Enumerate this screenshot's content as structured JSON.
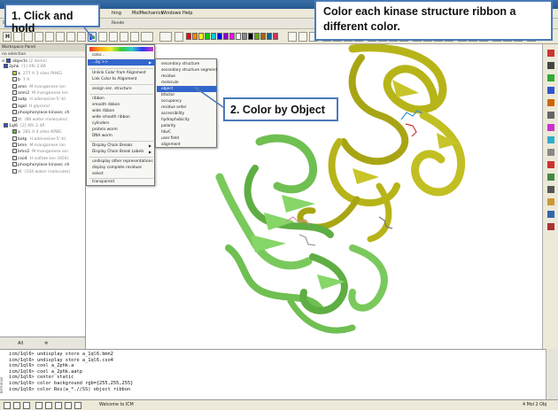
{
  "menubar": {
    "items": [
      "hing",
      "MolMechanics",
      "Windows",
      "Help"
    ]
  },
  "tabs": [
    "Struct",
    "Apps",
    "Fav",
    "Win",
    "Rende"
  ],
  "palette_colors": [
    "#ff0000",
    "#ff8800",
    "#ffff00",
    "#00cc00",
    "#00cccc",
    "#0000ff",
    "#8800cc",
    "#ff00ff",
    "#ffffff",
    "#888888",
    "#000000",
    "#66aa00",
    "#aa6600",
    "#006699",
    "#cc3366"
  ],
  "workspace": {
    "title": "Workspace Panel",
    "selection": "no selection",
    "objects_label": "objects",
    "objects_count": "(2 items)",
    "tree": [
      {
        "indent": 4,
        "color": "#3355cc",
        "name": "2phk",
        "detail": "[1] XRi 2.8Å",
        "gray": false
      },
      {
        "indent": 14,
        "color": "#cccc33",
        "name": "a",
        "detail": "277 A 3 sites PHKG",
        "gray": false
      },
      {
        "indent": 14,
        "color": "#ffffff",
        "name": "b",
        "detail": "7 A",
        "gray": false
      },
      {
        "indent": 14,
        "color": "#ffffff",
        "name": "amn",
        "detail": "M  manganese ion",
        "gray": false
      },
      {
        "indent": 14,
        "color": "#ffffff",
        "name": "amn2",
        "detail": "M  manganese ion",
        "gray": false
      },
      {
        "indent": 14,
        "color": "#ffffff",
        "name": "aatp",
        "detail": "H  adenosine-5'-tri",
        "gray": false
      },
      {
        "indent": 14,
        "color": "#ffffff",
        "name": "agol",
        "detail": "H  glycerol",
        "gray": false
      },
      {
        "indent": 14,
        "color": "#ffffff",
        "name": "phosphorylase kinase; ch",
        "detail": "",
        "gray": false
      },
      {
        "indent": 14,
        "color": "#ffffff",
        "name": "W",
        "detail": "(86 water molecules)",
        "gray": true
      },
      {
        "indent": 4,
        "color": "#3355cc",
        "name": "1ql6",
        "detail": "[2] XRi 2.4Å",
        "gray": false
      },
      {
        "indent": 14,
        "color": "#66bb44",
        "name": "a",
        "detail": "281 A 4 sites KPBG",
        "gray": false
      },
      {
        "indent": 14,
        "color": "#ffffff",
        "name": "batp",
        "detail": "H  adenosine-5'-tri",
        "gray": false
      },
      {
        "indent": 14,
        "color": "#ffffff",
        "name": "bmn",
        "detail": "M  manganese ion",
        "gray": false
      },
      {
        "indent": 14,
        "color": "#ffffff",
        "name": "bmn2",
        "detail": "M  manganese ion",
        "gray": false
      },
      {
        "indent": 14,
        "color": "#ffffff",
        "name": "cso4",
        "detail": "H  sulfate-ion (SO4)",
        "gray": false
      },
      {
        "indent": 14,
        "color": "#ffffff",
        "name": "phosphorylase kinase; ch",
        "detail": "",
        "gray": false
      },
      {
        "indent": 14,
        "color": "#ffffff",
        "name": "W",
        "detail": "(104 water molecules)",
        "gray": true
      }
    ],
    "bottom_tabs": [
      "All",
      "✲"
    ]
  },
  "context_menu": {
    "header": "color...",
    "items": [
      "...by >>",
      "Unlink Color from Alignment",
      "Link Color to Alignment",
      "assign sec. structure",
      "ribbon",
      "smooth ribbon",
      "wide ribbon",
      "wide smooth ribbon",
      "cylinders",
      "protein worm",
      "DNA worm",
      "Display Chain Breaks",
      "Display Chain Break Labels",
      "undisplay other representations",
      "display complete residues",
      "select",
      "transparent"
    ]
  },
  "submenu": {
    "items": [
      "secondary structure",
      "secondary structure segment",
      "residue",
      "molecule",
      "object",
      "bfactor",
      "occupancy",
      "residue order",
      "accessibility",
      "hydrophobicity",
      "polarity",
      "hbvC",
      "user field",
      "alignment"
    ],
    "highlighted": "object"
  },
  "callouts": {
    "step1": "1. Click and hold",
    "step2": "2. Color by Object",
    "instruction": "Color each kinase structure ribbon a different color."
  },
  "terminal": {
    "lines": [
      "icm/1ql6> undisplay store a_1ql6.bmn2",
      "icm/1ql6> undisplay store a_1ql6.cso4",
      "icm/1ql6> cool a_2phk.a",
      "icm/1ql6> cool a_2phk.aatp",
      "icm/1ql6> center static",
      "icm/1ql6> color background rgb={255,255,255}",
      "icm/1ql6> color Res(a_*.//SS) object ribbon"
    ],
    "side_label": "Terminal"
  },
  "status": {
    "welcome": "Welcome to ICM",
    "right": "4 Mol 2 Obj"
  },
  "colors": {
    "accent": "#4a7ab8",
    "highlight": "#3366cc",
    "ribbon_yellow": "#b7b41a",
    "ribbon_green": "#6fbf52"
  }
}
